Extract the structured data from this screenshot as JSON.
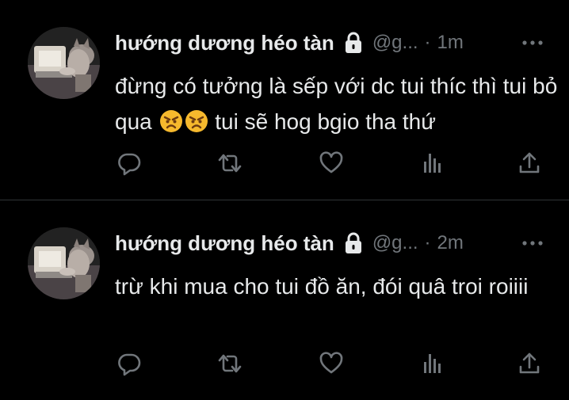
{
  "tweets": [
    {
      "author_name": "hướng dương héo tàn",
      "handle": "@g...",
      "separator": "·",
      "time": "1m",
      "text_part1": "đừng có tưởng là sếp với dc tui thíc thì tui bỏ qua ",
      "emoji": [
        "angry-face",
        "angry-face"
      ],
      "text_part2": " tui sẽ hog bgio tha thứ"
    },
    {
      "author_name": "hướng dương héo tàn",
      "handle": "@g...",
      "separator": "·",
      "time": "2m",
      "text_part1": "trừ khi mua cho tui đồ ăn, đói quâ troi roiiii",
      "emoji": [],
      "text_part2": ""
    }
  ],
  "icons": {
    "lock": "lock-icon",
    "more": "more-icon",
    "reply": "reply-icon",
    "retweet": "retweet-icon",
    "like": "heart-icon",
    "views": "views-icon",
    "share": "share-icon"
  },
  "colors": {
    "background": "#000000",
    "primary_text": "#e7e9ea",
    "secondary_text": "#71767b",
    "divider": "#2f3336"
  }
}
